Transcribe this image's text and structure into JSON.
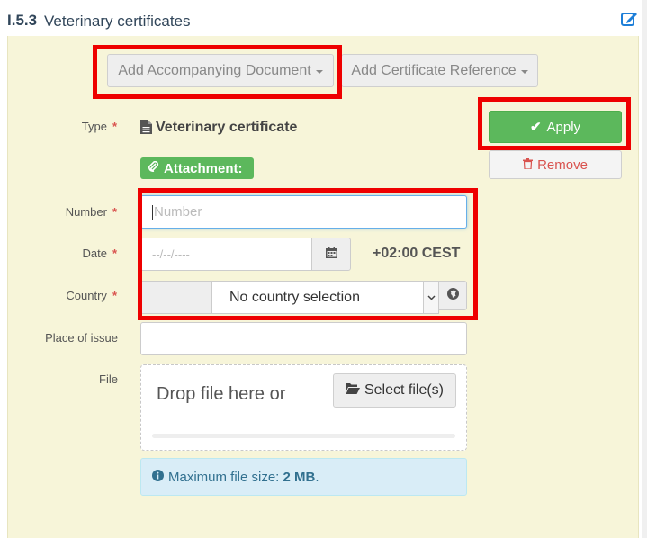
{
  "header": {
    "section_number": "I.5.3",
    "section_title": "Veterinary certificates"
  },
  "toolbar": {
    "add_document_label": "Add Accompanying Document",
    "add_reference_label": "Add Certificate Reference"
  },
  "form": {
    "type_label": "Type",
    "type_value": "Veterinary certificate",
    "attachment_badge": "Attachment:",
    "number_label": "Number",
    "number_placeholder": "Number",
    "date_label": "Date",
    "date_placeholder": "--/--/----",
    "timezone": "+02:00 CEST",
    "country_label": "Country",
    "country_value": "No country selection",
    "place_label": "Place of issue",
    "file_label": "File",
    "drop_text": "Drop file here or",
    "select_files_label": "Select file(s)",
    "info_prefix": "Maximum file size:",
    "info_value": "2 MB",
    "info_suffix": "."
  },
  "actions": {
    "apply_label": "Apply",
    "remove_label": "Remove"
  },
  "required_marker": "*",
  "colors": {
    "accent_green": "#5cb85c",
    "panel_bg": "#f7f5d9",
    "highlight_red": "#ee0000",
    "info_bg": "#d9edf7"
  }
}
